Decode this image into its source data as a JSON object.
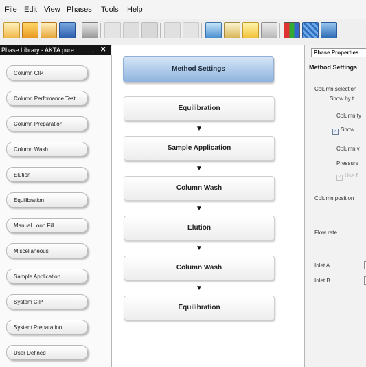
{
  "menu": [
    "File",
    "Edit",
    "View",
    "Phases",
    "Tools",
    "Help"
  ],
  "toolbar": {
    "icons": [
      "new-icon",
      "open-icon",
      "recent-icon",
      "save-icon",
      "print-icon",
      "cut-icon",
      "copy-icon",
      "paste-icon",
      "undo-icon",
      "redo-icon",
      "view-icon",
      "find-icon",
      "notes-icon",
      "report-icon",
      "chart-icon",
      "grid-icon",
      "settings-icon"
    ]
  },
  "phase_library": {
    "title": "Phase Library - AKTA pure...",
    "pin": "↓",
    "close": "✕",
    "items": [
      "Column CIP",
      "Column Perfomance Test",
      "Column Preparation",
      "Column Wash",
      "Elution",
      "Equilibration",
      "Manual Loop Fill",
      "Miscellaneous",
      "Sample Application",
      "System CIP",
      "System Preparation",
      "User Defined"
    ]
  },
  "method": {
    "settings_label": "Method Settings",
    "arrow": "▼",
    "phases": [
      "Equilibration",
      "Sample Application",
      "Column Wash",
      "Elution",
      "Column Wash",
      "Equilibration"
    ]
  },
  "properties": {
    "tab": "Phase Properties",
    "title": "Method Settings",
    "column_selection": "Column selection",
    "show_by": "Show by t",
    "column_type": "Column ty",
    "show": "Show",
    "column_volume": "Column v",
    "pressure": "Pressure",
    "use_flow": "Use fl",
    "column_position": "Column position",
    "flow_rate": "Flow rate",
    "inlet_a": "Inlet A",
    "inlet_b": "Inlet B"
  }
}
